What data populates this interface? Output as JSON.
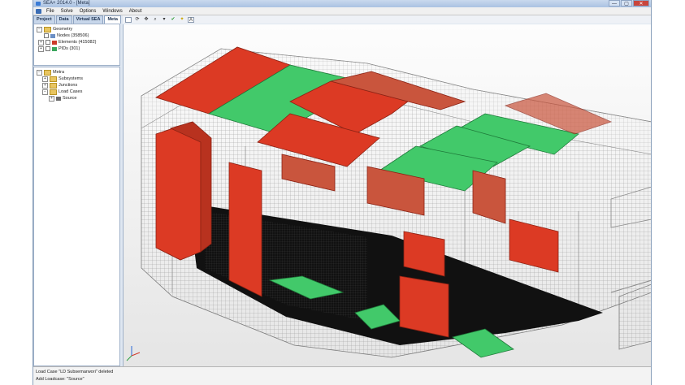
{
  "window": {
    "title": "SEA+ 2014.0 - [Meta]",
    "controls": {
      "minimize": "—",
      "maximize": "▢",
      "close": "✕"
    }
  },
  "menu": {
    "items": [
      "File",
      "Solve",
      "Options",
      "Windows",
      "About"
    ]
  },
  "tabs": [
    {
      "label": "Project",
      "active": false
    },
    {
      "label": "Data",
      "active": false
    },
    {
      "label": "Virtual SEA",
      "active": false
    },
    {
      "label": "Meta",
      "active": true
    }
  ],
  "tab_close": "×",
  "toolbar": {
    "icons": [
      "box-select-icon",
      "rotate-icon",
      "move-icon",
      "zoom-icon",
      "dropdown-icon",
      "check-icon",
      "light-icon",
      "text-box-icon"
    ],
    "text_box": "A"
  },
  "geometry_tree": {
    "root": "Geometry",
    "items": [
      "Nodes (358506)",
      "Elements (415082)",
      "PIDs (301)"
    ]
  },
  "meta_tree": {
    "root": "Metra",
    "items": [
      "Subsystems",
      "Junctions",
      "Load Cases"
    ],
    "sub_items": [
      "Source"
    ]
  },
  "expander": {
    "open": "−",
    "closed": "+"
  },
  "status": {
    "lines": [
      "Load Case \"LD Subsemarwori\" deleted",
      "Add Loadcase: \"Source\""
    ]
  },
  "colors": {
    "red_panel": "#dc3a24",
    "green_panel": "#42c96a",
    "mesh": "#8a8a8a",
    "floor": "#111111"
  }
}
